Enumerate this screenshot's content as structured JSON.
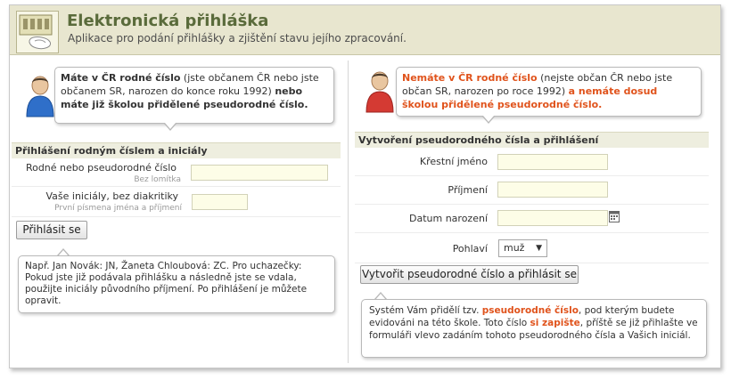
{
  "header": {
    "title": "Elektronická přihláška",
    "subtitle": "Aplikace pro podání přihlášky a zjištění stavu jejího zpracování."
  },
  "left": {
    "bubble": {
      "strong1": "Máte v ČR rodné číslo",
      "normal1": " (jste občanem ČR nebo jste občanem SR, narozen do konce roku 1992) ",
      "strong2": "nebo máte již školou přidělené pseudorodné číslo."
    },
    "section_title": "Přihlášení rodným číslem a iniciály",
    "field1": {
      "label": "Rodné nebo pseudorodné číslo",
      "hint": "Bez lomítka",
      "value": ""
    },
    "field2": {
      "label": "Vaše iniciály, bez diakritiky",
      "hint": "První písmena jména a příjmení",
      "value": ""
    },
    "login_button": "Přihlásit se",
    "note": "Např. Jan Novák: JN, Žaneta Chloubová: ZC. Pro uchazečky: Pokud jste již podávala přihlášku a následně jste se vdala, použijte iniciály původního příjmení. Po přihlášení je můžete opravit."
  },
  "right": {
    "bubble": {
      "strong1": "Nemáte v ČR rodné číslo",
      "normal1": " (nejste občan ČR nebo jste občan SR, narozen po roce 1992) ",
      "strong2": "a nemáte dosud školou přidělené pseudorodné číslo."
    },
    "section_title": "Vytvoření pseudorodného čísla a přihlášení",
    "first_name_label": "Křestní jméno",
    "last_name_label": "Příjmení",
    "birth_date_label": "Datum narození",
    "gender_label": "Pohlaví",
    "gender_value": "muž",
    "create_button": "Vytvořit pseudorodné číslo a přihlásit se",
    "note": {
      "p1": "Systém Vám přidělí tzv. ",
      "h1": "pseudorodné číslo",
      "p2": ", pod kterým budete evidováni na této škole. Toto číslo ",
      "h2": "si zapište",
      "p3": ", příště se již přihlašte ve formuláři vlevo zadáním tohoto pseudorodného čísla a Vašich iniciál."
    }
  },
  "colors": {
    "accent_green": "#5a6b3b",
    "accent_orange": "#e0531c",
    "header_bg": "#e8e6cf"
  }
}
